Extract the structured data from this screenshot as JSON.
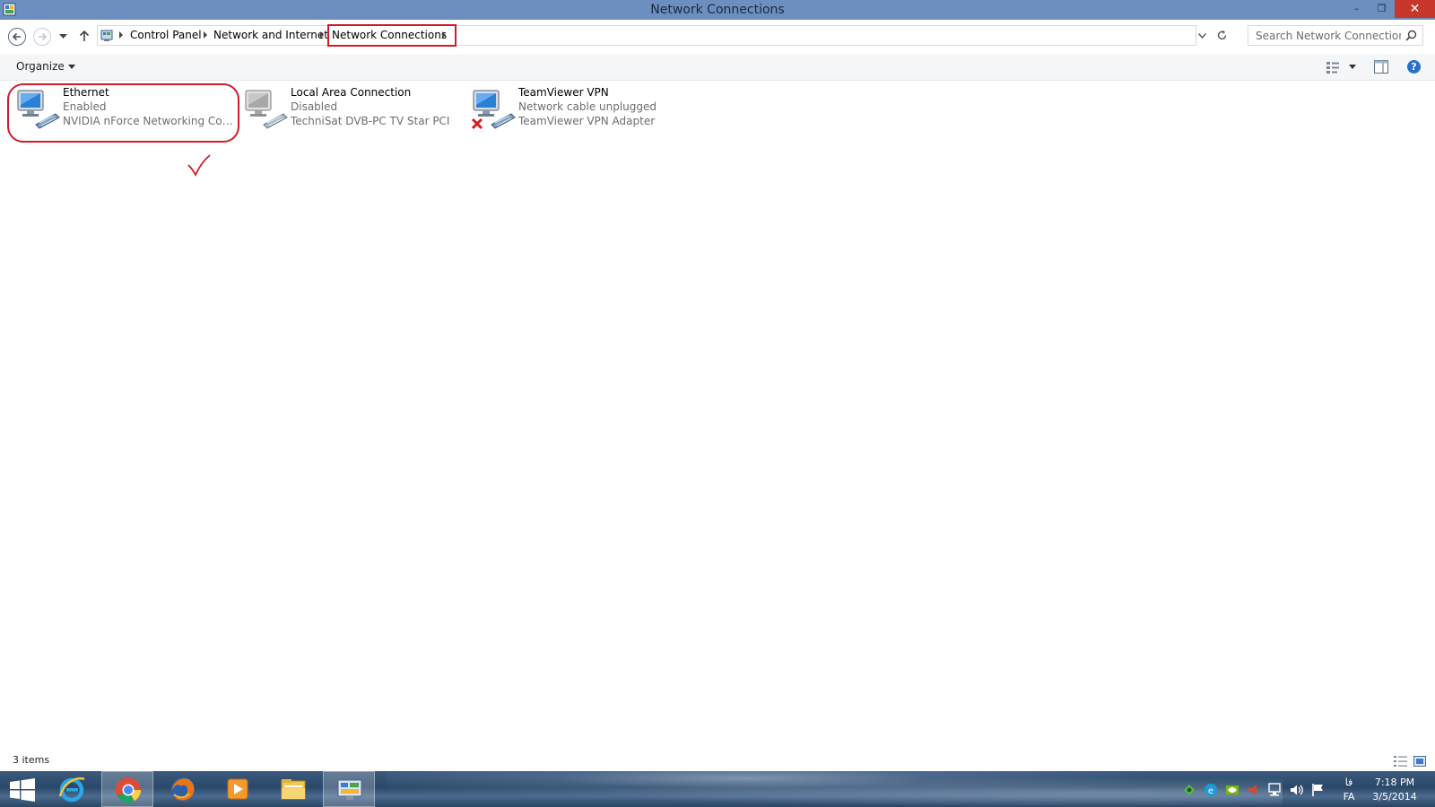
{
  "window": {
    "title": "Network Connections",
    "minimize_label": "–",
    "maximize_label": "❐",
    "close_label": "✕"
  },
  "address_bar": {
    "breadcrumbs": [
      "Control Panel",
      "Network and Internet",
      "Network Connections"
    ],
    "highlighted_crumb": "Network Connections"
  },
  "search": {
    "placeholder": "Search Network Connections"
  },
  "toolbar": {
    "organize_label": "Organize",
    "help_label": "?"
  },
  "connections": [
    {
      "name": "Ethernet",
      "status": "Enabled",
      "adapter": "NVIDIA nForce Networking Contr...",
      "icon": "network-adapter-icon",
      "highlighted": true
    },
    {
      "name": "Local Area Connection",
      "status": "Disabled",
      "adapter": "TechniSat DVB-PC TV Star PCI",
      "icon": "network-adapter-disabled-icon"
    },
    {
      "name": "TeamViewer VPN",
      "status": "Network cable unplugged",
      "adapter": "TeamViewer VPN Adapter",
      "icon": "network-adapter-unplugged-icon",
      "error_mark": "red-x"
    }
  ],
  "status_bar": {
    "item_count": "3 items"
  },
  "taskbar": {
    "pinned": [
      "start-icon",
      "internet-explorer-icon",
      "chrome-icon",
      "firefox-icon",
      "media-player-icon",
      "file-explorer-icon",
      "control-panel-icon"
    ],
    "active_app": "control-panel-icon",
    "language_script": "فا",
    "language_code": "FA",
    "time": "7:18 PM",
    "date": "3/5/2014"
  },
  "colors": {
    "titlebar": "#6c8fc0",
    "close_button": "#c7362b",
    "annotation_red": "#d11a2a",
    "secondary_text": "#6d6d6d"
  }
}
